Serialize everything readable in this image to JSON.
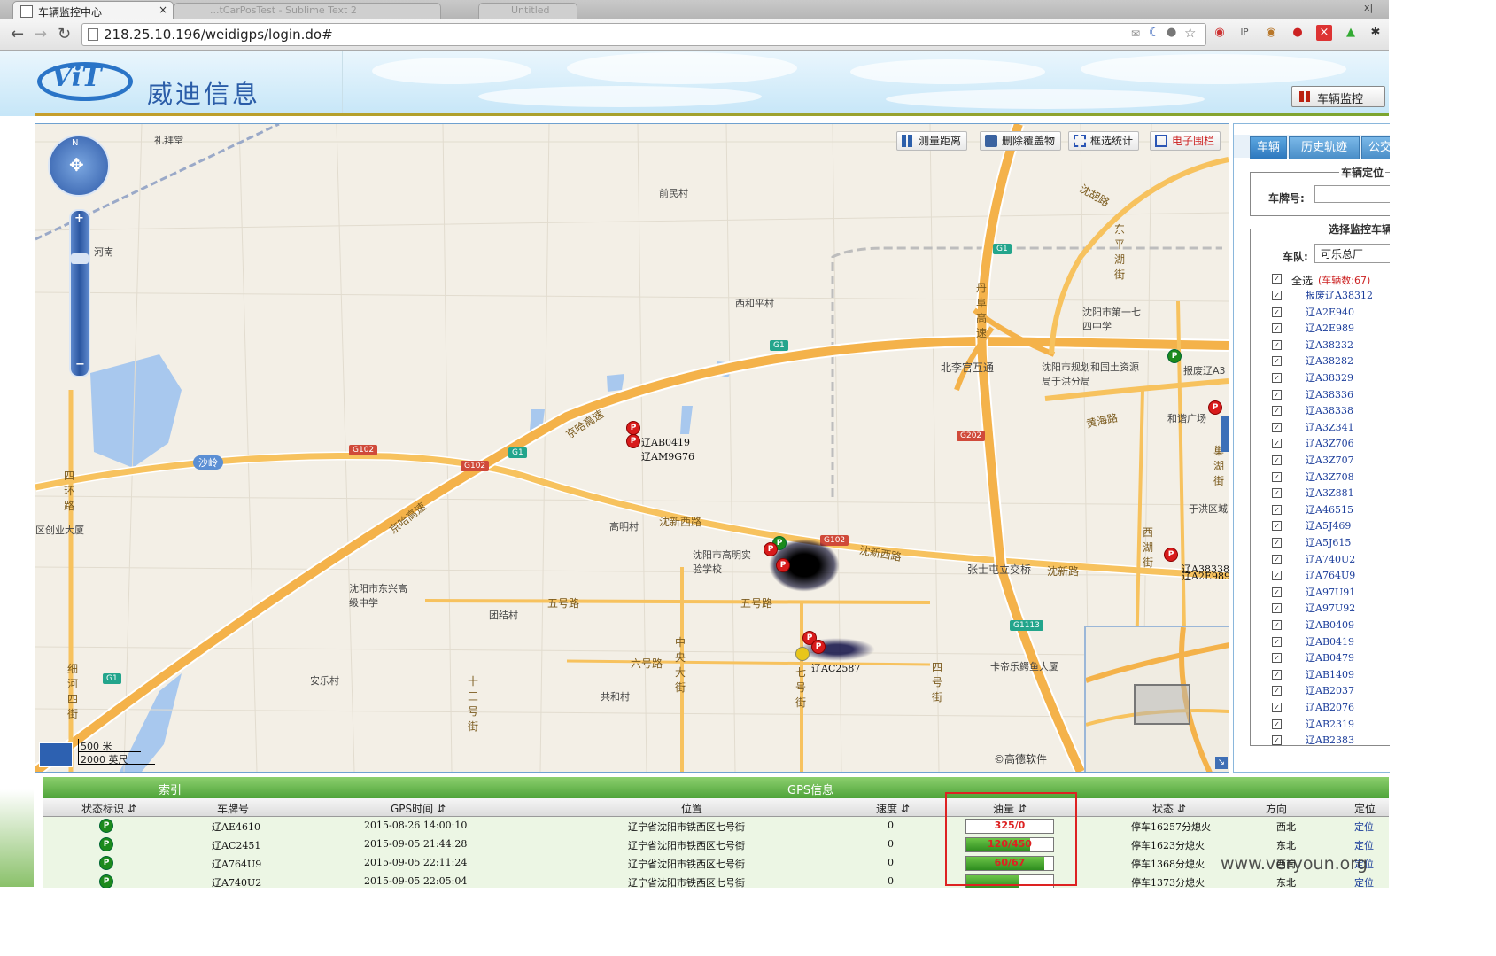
{
  "browser": {
    "tabs": [
      {
        "title": "车辆监控中心",
        "active": true
      },
      {
        "title": "...tCarPosTest - Sublime Text 2",
        "active": false
      },
      {
        "title": "Untitled",
        "active": false
      }
    ],
    "close_glyph": "×",
    "url": "218.25.10.196/weidigps/login.do#"
  },
  "header": {
    "logo_text": "ViT",
    "company_name": "威迪信息",
    "vehicle_monitor_button": "车辆监控"
  },
  "map": {
    "tools": [
      "测量距离",
      "删除覆盖物",
      "框选统计",
      "电子围栏"
    ],
    "scale_metric": "500 米",
    "scale_imperial": "2000 英尺",
    "copyright": "©高德软件",
    "compass_n": "N",
    "places": [
      "礼拜堂",
      "前民村",
      "河南",
      "西和平村",
      "沈阳市第一七四中学",
      "北李官互通",
      "沈阳市规划和国土资源局于洪分局",
      "和谐广场",
      "于洪区城",
      "区创业大厦",
      "高明村",
      "沈阳市高明实验学校",
      "沈阳市东兴高级中学",
      "团结村",
      "安乐村",
      "共和村",
      "卡帝乐鳄鱼大厦",
      "张士屯立交桥",
      "报废辽A3"
    ],
    "roads": [
      "京哈高速",
      "沈新西路",
      "五号路",
      "六号路",
      "中央大街",
      "七号街",
      "四号街",
      "丹阜高速",
      "黄海路",
      "沈新路",
      "沈胡路",
      "四环路",
      "十三号街",
      "细河四街",
      "西湖街",
      "巢湖街",
      "东平湖街",
      "沙岭"
    ],
    "shields": [
      "G1",
      "G102",
      "G202",
      "G1113"
    ],
    "vehicle_labels": [
      "辽AB0419",
      "辽AM9G76",
      "辽AC2587",
      "辽A38338",
      "辽A2E989"
    ]
  },
  "side_panel": {
    "tabs": [
      "车辆",
      "历史轨迹",
      "公交"
    ],
    "locate_legend": "车辆定位",
    "plate_label": "车牌号:",
    "plate_value": "",
    "select_legend": "选择监控车辆",
    "fleet_label": "车队:",
    "fleet_value": "可乐总厂",
    "select_all": "全选",
    "vehicle_count": "(车辆数:67)",
    "vehicles": [
      "报废辽A38312",
      "辽A2E940",
      "辽A2E989",
      "辽A38232",
      "辽A38282",
      "辽A38329",
      "辽A38336",
      "辽A38338",
      "辽A3Z341",
      "辽A3Z706",
      "辽A3Z707",
      "辽A3Z708",
      "辽A3Z881",
      "辽A46515",
      "辽A5J469",
      "辽A5J615",
      "辽A740U2",
      "辽A764U9",
      "辽A97U91",
      "辽A97U92",
      "辽AB0409",
      "辽AB0419",
      "辽AB0479",
      "辽AB1409",
      "辽AB2037",
      "辽AB2076",
      "辽AB2319",
      "辽AB2383"
    ]
  },
  "grid": {
    "group_headers": [
      "索引",
      "GPS信息"
    ],
    "columns": [
      "状态标识",
      "车牌号",
      "GPS时间",
      "位置",
      "速度",
      "油量",
      "状态",
      "方向",
      "定位"
    ],
    "rows": [
      {
        "status_icon": "P",
        "plate": "辽AE4610",
        "time": "2015-08-26 14:00:10",
        "location": "辽宁省沈阳市铁西区七号街",
        "speed": "0",
        "fuel": "325/0",
        "fuel_fraction": 0.0,
        "state": "停车16257分熄火",
        "direction": "西北",
        "locate": "定位"
      },
      {
        "status_icon": "P",
        "plate": "辽AC2451",
        "time": "2015-09-05 21:44:28",
        "location": "辽宁省沈阳市铁西区七号街",
        "speed": "0",
        "fuel": "120/450",
        "fuel_fraction": 0.73,
        "state": "停车1623分熄火",
        "direction": "东北",
        "locate": "定位"
      },
      {
        "status_icon": "P",
        "plate": "辽A764U9",
        "time": "2015-09-05 22:11:24",
        "location": "辽宁省沈阳市铁西区七号街",
        "speed": "0",
        "fuel": "60/67",
        "fuel_fraction": 0.9,
        "state": "停车1368分熄火",
        "direction": "西南",
        "locate": "定位"
      },
      {
        "status_icon": "P",
        "plate": "辽A740U2",
        "time": "2015-09-05 22:05:04",
        "location": "辽宁省沈阳市铁西区七号街",
        "speed": "0",
        "fuel": "",
        "fuel_fraction": 0.6,
        "state": "停车1373分熄火",
        "direction": "东北",
        "locate": "定位"
      }
    ]
  },
  "watermark": "www.veryoun.org",
  "colors": {
    "accent_blue": "#2a74c7",
    "grid_green": "#4ea339",
    "highlight_red": "#dd2222",
    "road_orange": "#f4b24a"
  }
}
